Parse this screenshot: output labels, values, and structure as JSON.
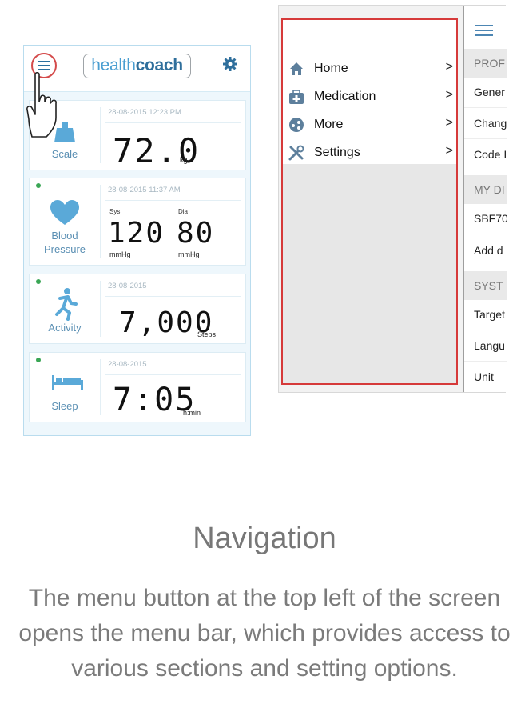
{
  "left_app": {
    "logo_part1": "health",
    "logo_part2": "coach",
    "cards": {
      "scale": {
        "label": "Scale",
        "date": "28-08-2015 12:23 PM",
        "value": "72.0",
        "unit": "kg"
      },
      "blood_pressure": {
        "label_line1": "Blood",
        "label_line2": "Pressure",
        "date": "28-08-2015 11:37 AM",
        "sys_label": "Sys",
        "dia_label": "Dia",
        "sys_value": "120",
        "dia_value": "80",
        "sys_unit": "mmHg",
        "dia_unit": "mmHg"
      },
      "activity": {
        "label": "Activity",
        "date": "28-08-2015",
        "value": "7,000",
        "unit": "Steps"
      },
      "sleep": {
        "label": "Sleep",
        "date": "28-08-2015",
        "value": "7:05",
        "unit": "h:min"
      }
    }
  },
  "right_app": {
    "menu_items": [
      {
        "label": "Home",
        "icon": "home-icon"
      },
      {
        "label": "Medication",
        "icon": "medication-icon"
      },
      {
        "label": "More",
        "icon": "more-icon"
      },
      {
        "label": "Settings",
        "icon": "settings-icon"
      }
    ],
    "chevron": ">",
    "settings_panel": {
      "header_profile": "PROF",
      "item_general": "Gener",
      "item_change": "Chang",
      "item_code": "Code I",
      "header_my_devices": "MY DI",
      "item_device": "SBF70",
      "item_add": "Add d",
      "header_system": "SYST",
      "item_target": "Target",
      "item_language": "Langu",
      "item_unit": "Unit"
    }
  },
  "caption": {
    "title": "Navigation",
    "text": "The menu button at the top left of the screen opens the menu bar, which provides access to various sections and setting options."
  },
  "colors": {
    "accent_blue": "#4a9ed1",
    "highlight_red": "#d63a3a",
    "status_green": "#3aa655"
  }
}
